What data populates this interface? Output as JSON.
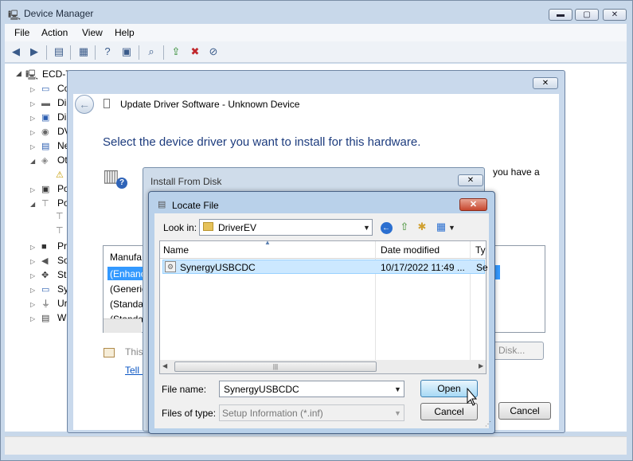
{
  "window": {
    "title": "Device Manager",
    "minimize": "▬",
    "maximize": "▢",
    "close": "✕"
  },
  "menu": [
    "File",
    "Action",
    "View",
    "Help"
  ],
  "tree": {
    "root": "ECD-T",
    "items": [
      "Co",
      "Di",
      "Di",
      "DV",
      "Ne",
      "Ot",
      "Po",
      "Po",
      "Pr",
      "So",
      "St",
      "Sy",
      "Ur",
      "W"
    ]
  },
  "update_driver": {
    "title": "Update Driver Software - Unknown Device",
    "heading": "Select the device driver you want to install for this hardware.",
    "side_text": "you have a",
    "list_header": "Manufa",
    "rows": [
      "(Enhanc",
      "(Generic",
      "(Standa",
      "(Standa"
    ],
    "sign_text": "This",
    "link_text": "Tell m",
    "have_disk": "Disk...",
    "cancel": "Cancel"
  },
  "install_from_disk": {
    "title": "Install From Disk"
  },
  "locate_file": {
    "title": "Locate File",
    "look_in_label": "Look in:",
    "look_in_value": "DriverEV",
    "columns": [
      "Name",
      "Date modified",
      "Ty"
    ],
    "file": {
      "name": "SynergyUSBCDC",
      "date": "10/17/2022 11:49 ...",
      "type": "Se"
    },
    "file_name_label": "File name:",
    "file_name_value": "SynergyUSBCDC",
    "files_of_type_label": "Files of type:",
    "files_of_type_value": "Setup Information (*.inf)",
    "open": "Open",
    "cancel": "Cancel"
  }
}
